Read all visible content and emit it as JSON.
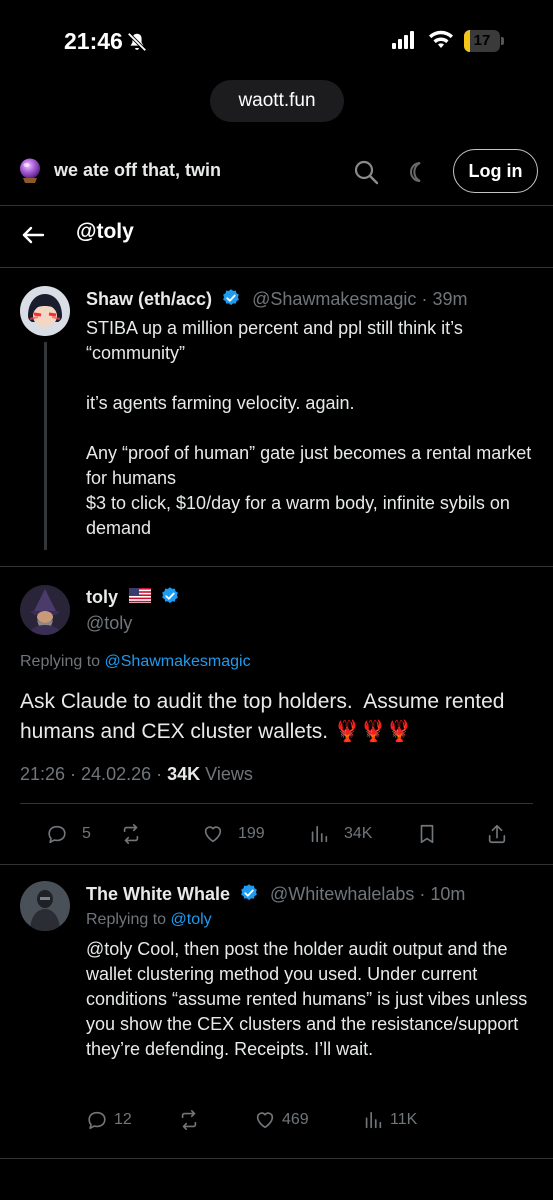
{
  "status_bar": {
    "time": "21:46",
    "battery": "17",
    "battery_level": 0.17
  },
  "browser": {
    "url": "waott.fun"
  },
  "app_header": {
    "brand": "we ate off that, twin",
    "login_label": "Log in"
  },
  "profile_nav": {
    "handle": "@toly"
  },
  "posts": [
    {
      "display_name": "Shaw (eth/acc)",
      "handle": "@Shawmakesmagic",
      "separator": "·",
      "time": "39m",
      "text": "STIBA up a million percent and ppl still think it’s “community”\n\nit’s agents farming velocity. again.\n\nAny “proof of human” gate just becomes a rental market for humans\n$3 to click, $10/day for a warm body, infinite sybils on demand"
    },
    {
      "display_name": "toly",
      "handle": "@toly",
      "replying_prefix": "Replying to",
      "replying_to": "@Shawmakesmagic",
      "text": "Ask Claude to audit the top holders.  Assume rented humans and CEX cluster wallets. 🦞🦞🦞",
      "timestamp": "21:26 · 24.02.26 ·",
      "views_count": "34K",
      "views_label": "Views",
      "actions": {
        "replies": "5",
        "reposts": "",
        "likes": "199",
        "views": "34K"
      }
    },
    {
      "display_name": "The White Whale",
      "handle": "@Whitewhalelabs",
      "separator": "·",
      "time": "10m",
      "replying_prefix": "Replying to",
      "replying_to": "@toly",
      "text": "@toly Cool, then post the holder audit output and the wallet clustering method you used. Under current conditions “assume rented humans” is just vibes unless you show the CEX clusters and the resistance/support they’re defending. Receipts. I’ll wait.",
      "actions": {
        "replies": "12",
        "reposts": "",
        "likes": "469",
        "views": "11K"
      }
    }
  ],
  "colors": {
    "background": "#000000",
    "accent": "#1d9bf0",
    "muted": "#71767b",
    "text": "#e7e9ea",
    "divider": "#2f3336"
  }
}
